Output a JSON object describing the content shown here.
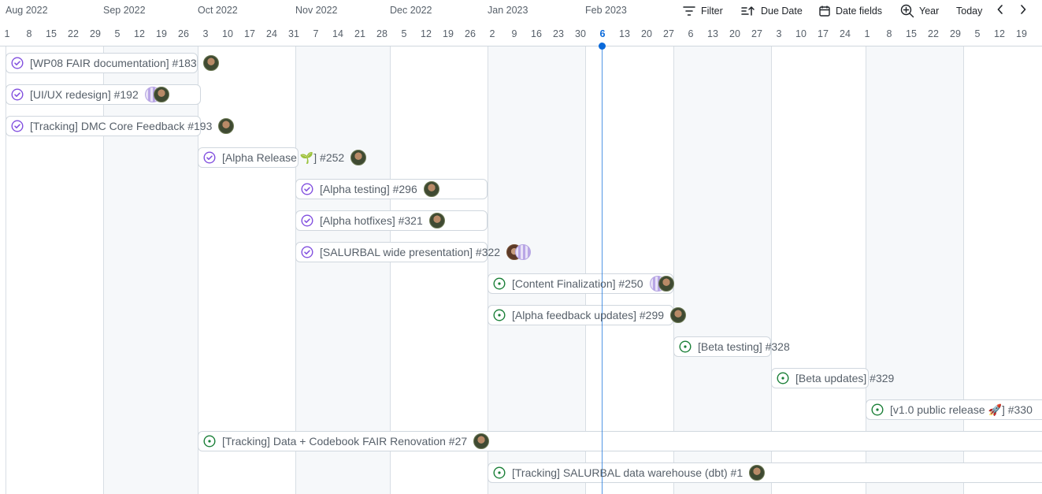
{
  "toolbar": {
    "filter_label": "Filter",
    "sort_label": "Due Date",
    "date_fields_label": "Date fields",
    "zoom_label": "Year",
    "today_label": "Today"
  },
  "timeline": {
    "months": [
      "Aug 2022",
      "Sep 2022",
      "Oct 2022",
      "Nov 2022",
      "Dec 2022",
      "Jan 2023",
      "Feb 2023"
    ],
    "days": [
      "1",
      "8",
      "15",
      "22",
      "29",
      "5",
      "12",
      "19",
      "26",
      "3",
      "10",
      "17",
      "24",
      "31",
      "7",
      "14",
      "21",
      "28",
      "5",
      "12",
      "19",
      "26",
      "2",
      "9",
      "16",
      "23",
      "30",
      "6",
      "13",
      "20",
      "27",
      "6",
      "13",
      "20",
      "27",
      "3",
      "10",
      "17",
      "24",
      "1",
      "8",
      "15",
      "22",
      "29",
      "5",
      "12",
      "19"
    ],
    "today_day": "6"
  },
  "items": [
    {
      "title": "[WP08 FAIR documentation] #183",
      "status": "closed"
    },
    {
      "title": "[UI/UX redesign] #192",
      "status": "closed"
    },
    {
      "title": "[Tracking] DMC Core Feedback #193",
      "status": "closed"
    },
    {
      "title": "[Alpha Release 🌱] #252",
      "status": "closed"
    },
    {
      "title": "[Alpha testing] #296",
      "status": "closed"
    },
    {
      "title": "[Alpha hotfixes] #321",
      "status": "closed"
    },
    {
      "title": "[SALURBAL wide presentation] #322",
      "status": "closed"
    },
    {
      "title": "[Content Finalization] #250",
      "status": "open"
    },
    {
      "title": "[Alpha feedback updates] #299",
      "status": "open"
    },
    {
      "title": "[Beta testing] #328",
      "status": "open"
    },
    {
      "title": "[Beta updates] #329",
      "status": "open"
    },
    {
      "title": "[v1.0 public release 🚀] #330",
      "status": "open"
    },
    {
      "title": "[Tracking] Data + Codebook FAIR Renovation #27",
      "status": "open"
    },
    {
      "title": "[Tracking] SALURBAL data warehouse (dbt) #1",
      "status": "open"
    }
  ],
  "colors": {
    "closed_status": "#8250df",
    "open_status": "#1a7f37",
    "today_line": "#0969da"
  }
}
